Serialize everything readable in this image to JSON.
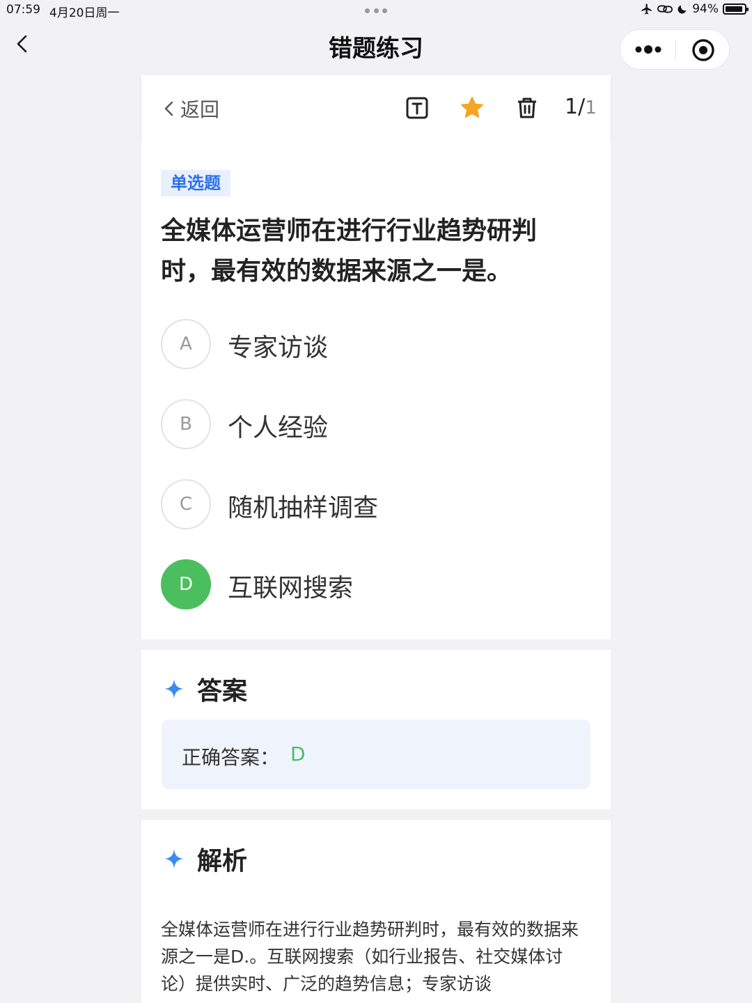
{
  "status_bar": {
    "time": "07:59",
    "date": "4月20日周一",
    "battery": "94%",
    "battery_level": 0.94
  },
  "nav": {
    "title": "错题练习"
  },
  "toolbar": {
    "back_label": "返回",
    "page_current": "1",
    "page_sep": "/",
    "page_total": "1",
    "star_color": "#f5a623"
  },
  "question": {
    "type": "单选题",
    "stem": "全媒体运营师在进行行业趋势研判时，最有效的数据来源之一是。",
    "options": [
      {
        "letter": "A",
        "text": "专家访谈",
        "correct": false
      },
      {
        "letter": "B",
        "text": "个人经验",
        "correct": false
      },
      {
        "letter": "C",
        "text": "随机抽样调查",
        "correct": false
      },
      {
        "letter": "D",
        "text": "互联网搜索",
        "correct": true
      }
    ]
  },
  "answer": {
    "heading": "答案",
    "label": "正确答案：",
    "value": "D"
  },
  "analysis": {
    "heading": "解析",
    "text": "全媒体运营师在进行行业趋势研判时，最有效的数据来源之一是D.。互联网搜索（如行业报告、社交媒体讨论）提供实时、广泛的趋势信息；专家访谈"
  },
  "colors": {
    "accent_blue": "#2d6fe8",
    "correct_green": "#4bbf5e"
  }
}
